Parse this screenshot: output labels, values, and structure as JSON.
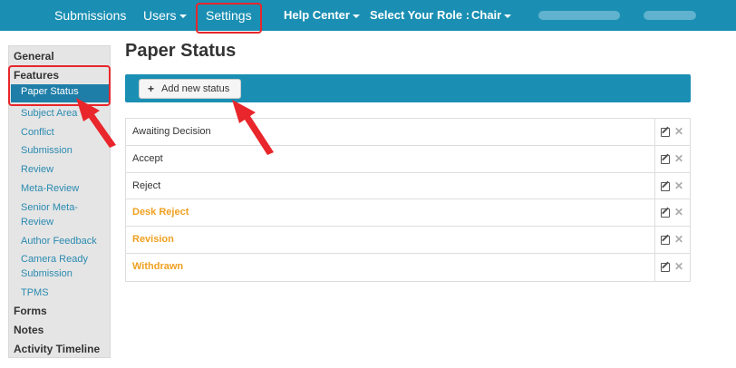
{
  "nav": {
    "submissions": "Submissions",
    "users": "Users",
    "settings": "Settings",
    "help_center": "Help Center",
    "select_role_label": "Select Your Role :",
    "role": "Chair"
  },
  "sidebar": {
    "general": "General",
    "features": "Features",
    "features_items": [
      "Paper Status",
      "Subject Area",
      "Conflict",
      "Submission",
      "Review",
      "Meta-Review",
      "Senior Meta-Review",
      "Author Feedback",
      "Camera Ready Submission",
      "TPMS"
    ],
    "forms": "Forms",
    "notes": "Notes",
    "activity_timeline": "Activity Timeline"
  },
  "page": {
    "title": "Paper Status",
    "add_button": "Add new status"
  },
  "statuses": [
    {
      "name": "Awaiting Decision"
    },
    {
      "name": "Accept"
    },
    {
      "name": "Reject"
    },
    {
      "name": "Desk Reject"
    },
    {
      "name": "Revision"
    },
    {
      "name": "Withdrawn"
    }
  ],
  "colors": {
    "navbar": "#1a8fb3",
    "sidebar_active": "#1e7ea8",
    "highlight": "#e8262b",
    "warn_text": "#f0a020"
  }
}
